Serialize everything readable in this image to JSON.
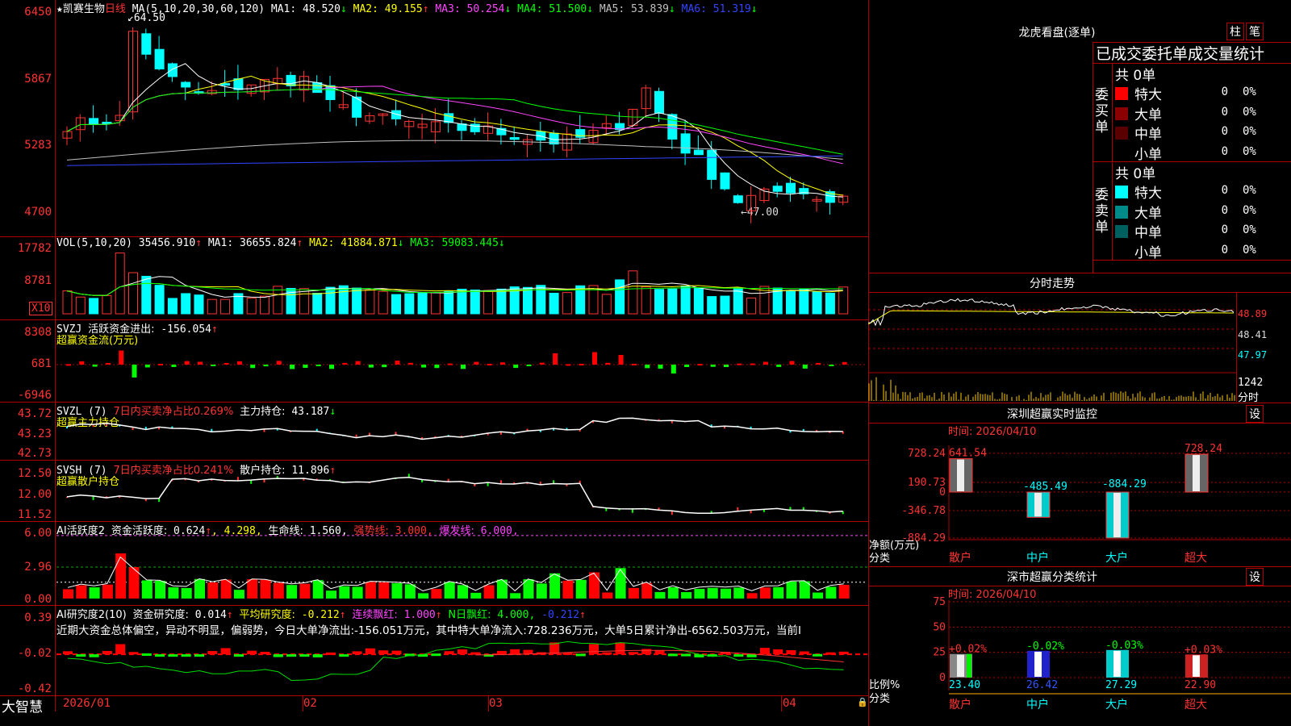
{
  "stock": {
    "star": "★",
    "name": "凯赛生物",
    "period": "日线"
  },
  "main_chart": {
    "y_labels": [
      "6450",
      "5867",
      "5283",
      "4700"
    ],
    "high_note": "64.50",
    "low_note": "←47.00",
    "legend": {
      "formula": "MA(5,10,20,30,60,120)",
      "items": [
        {
          "label": "MA1:",
          "value": "48.520",
          "arrow": "↓",
          "color": "#ffffff"
        },
        {
          "label": "MA2:",
          "value": "49.155",
          "arrow": "↑",
          "color": "#ffff00"
        },
        {
          "label": "MA3:",
          "value": "50.254",
          "arrow": "↓",
          "color": "#ff44ff"
        },
        {
          "label": "MA4:",
          "value": "51.500",
          "arrow": "↓",
          "color": "#00ff00"
        },
        {
          "label": "MA5:",
          "value": "53.839",
          "arrow": "↓",
          "color": "#c0c0c0"
        },
        {
          "label": "MA6:",
          "value": "51.319",
          "arrow": "↓",
          "color": "#3344ff"
        }
      ]
    }
  },
  "vol_chart": {
    "y_labels": [
      "17782",
      "8781"
    ],
    "unit": "X10",
    "legend": {
      "formula": "VOL(5,10,20)",
      "value": "35456.910",
      "arrow": "↑",
      "items": [
        {
          "label": "MA1:",
          "value": "36655.824",
          "arrow": "↑",
          "color": "#ffffff"
        },
        {
          "label": "MA2:",
          "value": "41884.871",
          "arrow": "↓",
          "color": "#ffff00"
        },
        {
          "label": "MA3:",
          "value": "59083.445",
          "arrow": "↓",
          "color": "#00ff00"
        }
      ]
    }
  },
  "svzj": {
    "y_labels": [
      "8308",
      "681",
      "-6946"
    ],
    "legend_name": "SVZJ",
    "legend_text": "活跃资金进出:",
    "legend_value": "-156.054",
    "legend_arrow": "↑",
    "subtitle": "超赢资金流(万元)"
  },
  "svzl": {
    "y_labels": [
      "43.72",
      "43.23",
      "42.73"
    ],
    "legend_name": "SVZL (7)",
    "legend_text": "7日内买卖净占比0.269%",
    "legend_text2": "主力持仓:",
    "legend_value": "43.187",
    "legend_arrow": "↓",
    "subtitle": "超赢主力持仓"
  },
  "svsh": {
    "y_labels": [
      "12.50",
      "12.00",
      "11.52"
    ],
    "legend_name": "SVSH (7)",
    "legend_text": "7日内买卖净占比0.241%",
    "legend_text2": "散户持仓:",
    "legend_value": "11.896",
    "legend_arrow": "↑",
    "subtitle": "超赢散户持仓"
  },
  "ai_active": {
    "y_labels": [
      "6.00",
      "2.96",
      "0.00"
    ],
    "legend_name": "AI活跃度2",
    "legend_text": "资金活跃度:",
    "legend_value": "0.624",
    "legend_arrow": "↑",
    "legend_v2": "4.298",
    "legend_text3": "生命线:",
    "legend_v3": "1.560",
    "legend_text4": "强势线:",
    "legend_v4": "3.000",
    "legend_text5": "爆发线:",
    "legend_v5": "6.000"
  },
  "ai_research": {
    "y_labels": [
      "0.39",
      "-0.02",
      "-0.42"
    ],
    "legend_name": "AI研究度2(10)",
    "legend_text": "资金研究度:",
    "legend_value": "0.014",
    "legend_arrow": "↑",
    "legend_text2": "平均研究度:",
    "legend_v2": "-0.212",
    "legend_text3": "连续飘红:",
    "legend_v3": "1.000",
    "legend_text4": "N日飘红:",
    "legend_v4": "4.000",
    "legend_v5": "-0.212",
    "summary": "近期大资金总体偏空，异动不明显，偏弱势，今日大单净流出:-156.051万元，其中特大单净流入:728.236万元，大单5日累计净出-6562.503万元，当前I"
  },
  "x_axis": {
    "labels": [
      "2026/01",
      "02",
      "03",
      "04"
    ],
    "brand": "大智慧"
  },
  "right_panel": {
    "dragon_title": "龙虎看盘(逐单)",
    "btn_zhu": "柱",
    "btn_bi": "笔",
    "stat_title": "已成交委托单成交量统计",
    "buy_group_label": "委买单",
    "sell_group_label": "委卖单",
    "buy_total": "共 0单",
    "sell_total": "共 0单",
    "buy_rows": [
      {
        "name": "特大",
        "count": "0",
        "pct": "0%",
        "color": "#ff0000"
      },
      {
        "name": "大单",
        "count": "0",
        "pct": "0%",
        "color": "#8b0000"
      },
      {
        "name": "中单",
        "count": "0",
        "pct": "0%",
        "color": "#5a0000"
      },
      {
        "name": "小单",
        "count": "0",
        "pct": "0%",
        "color": "#000000"
      }
    ],
    "sell_rows": [
      {
        "name": "特大",
        "count": "0",
        "pct": "0%",
        "color": "#00ffff"
      },
      {
        "name": "大单",
        "count": "0",
        "pct": "0%",
        "color": "#008b8b"
      },
      {
        "name": "中单",
        "count": "0",
        "pct": "0%",
        "color": "#006060"
      },
      {
        "name": "小单",
        "count": "0",
        "pct": "0%",
        "color": "#000000"
      }
    ],
    "intraday_title": "分时走势",
    "intraday_labels": [
      "48.89",
      "48.41",
      "47.97",
      "1242",
      "分时"
    ],
    "monitor_title": "深圳超赢实时监控",
    "monitor_btn": "设",
    "monitor_time": "时间: 2026/04/10",
    "monitor_y": [
      "728.24",
      "190.73",
      "0",
      "-346.78",
      "-884.29"
    ],
    "monitor_axis_title": "净额(万元)",
    "monitor_axis_sub": "分类",
    "monitor_cats": [
      "散户",
      "中户",
      "大户",
      "超大"
    ],
    "monitor_values": [
      641.54,
      -485.49,
      -884.29,
      728.24
    ],
    "monitor_value_labels": [
      "641.54",
      "-485.49",
      "-884.29",
      "728.24"
    ],
    "class_title": "深市超赢分类统计",
    "class_btn": "设",
    "class_time": "时间: 2026/04/10",
    "class_y": [
      "75",
      "50",
      "25",
      "0"
    ],
    "class_axis_title": "比例%",
    "class_axis_sub": "分类",
    "class_cats": [
      "散户",
      "中户",
      "大户",
      "超大"
    ],
    "class_values": [
      23.4,
      26.42,
      27.29,
      22.9
    ],
    "class_value_labels": [
      "23.40",
      "26.42",
      "27.29",
      "22.90"
    ],
    "class_change_labels": [
      "+0.02%",
      "-0.02%",
      "-0.03%",
      "+0.03%"
    ]
  }
}
